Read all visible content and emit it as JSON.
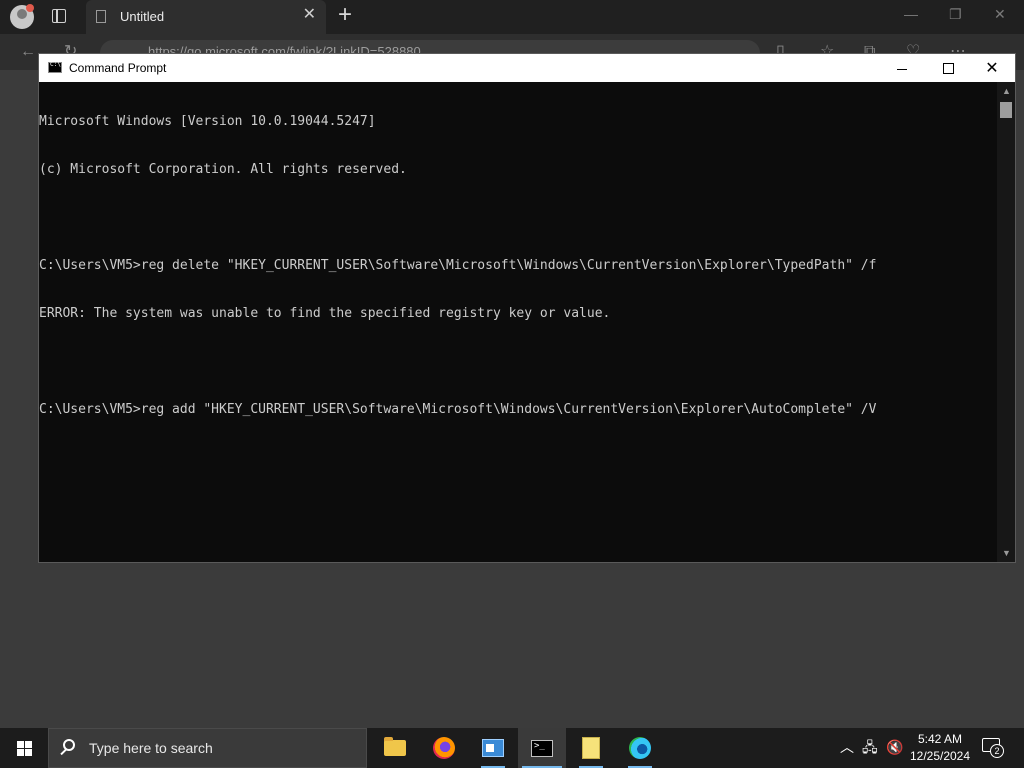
{
  "browser": {
    "tab_title": "Untitled",
    "address_text": "https://go.microsoft.com/fwlink/?LinkID=528880",
    "accent_color": "#202020"
  },
  "cmd_window": {
    "title": "Command Prompt",
    "lines": [
      "Microsoft Windows [Version 10.0.19044.5247]",
      "(c) Microsoft Corporation. All rights reserved.",
      "",
      "C:\\Users\\VM5>reg delete \"HKEY_CURRENT_USER\\Software\\Microsoft\\Windows\\CurrentVersion\\Explorer\\TypedPath\" /f",
      "ERROR: The system was unable to find the specified registry key or value.",
      "",
      "C:\\Users\\VM5>reg add \"HKEY_CURRENT_USER\\Software\\Microsoft\\Windows\\CurrentVersion\\Explorer\\AutoComplete\" /V"
    ],
    "background_color": "#0c0c0c",
    "text_color": "#cccccc"
  },
  "taskbar": {
    "search_placeholder": "Type here to search",
    "apps": [
      {
        "name": "file-explorer",
        "icon": "folder-icon"
      },
      {
        "name": "firefox",
        "icon": "firefox-icon"
      },
      {
        "name": "control-panel",
        "icon": "control-panel-icon"
      },
      {
        "name": "command-prompt",
        "icon": "cmd-icon",
        "active": true
      },
      {
        "name": "sticky-notes",
        "icon": "notes-icon"
      },
      {
        "name": "edge",
        "icon": "edge-icon"
      }
    ],
    "clock_time": "5:42 AM",
    "clock_date": "12/25/2024",
    "notification_count": "2"
  }
}
